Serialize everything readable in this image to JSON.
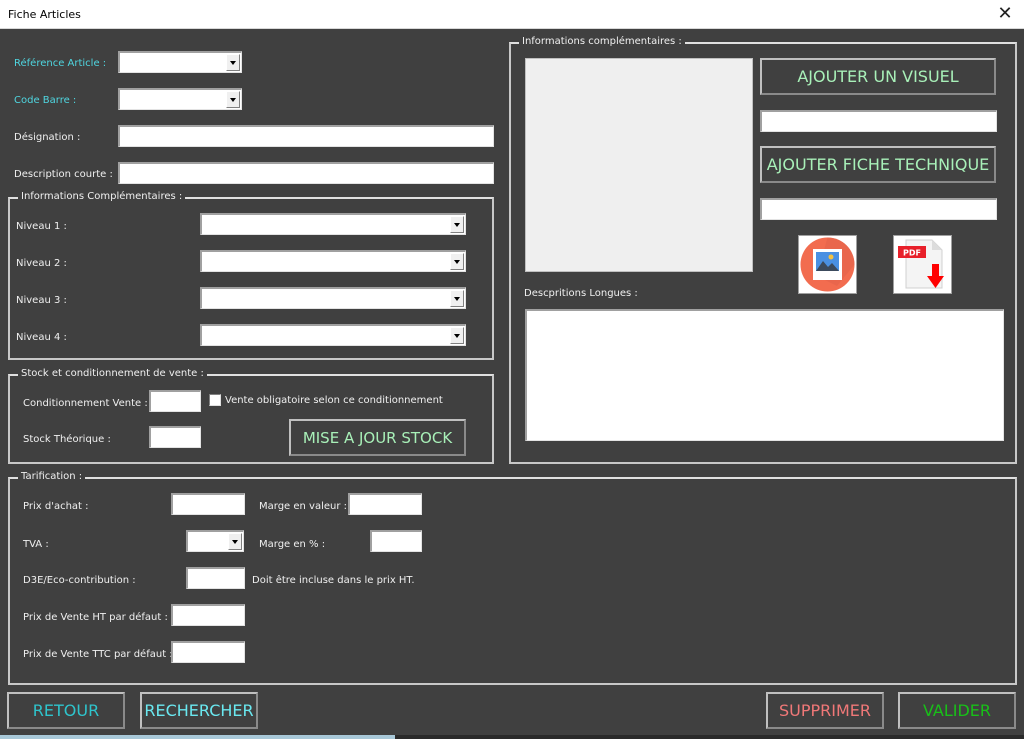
{
  "window": {
    "title": "Fiche Articles",
    "close_icon": "close-icon"
  },
  "article": {
    "reference_label": "Référence Article :",
    "reference_value": "",
    "barcode_label": "Code Barre :",
    "barcode_value": "",
    "designation_label": "Désignation :",
    "designation_value": "",
    "short_description_label": "Description courte :",
    "short_description_value": ""
  },
  "info_group": {
    "title": "Informations Complémentaires :",
    "levels": [
      {
        "label": "Niveau 1 :",
        "value": ""
      },
      {
        "label": "Niveau 2 :",
        "value": ""
      },
      {
        "label": "Niveau 3 :",
        "value": ""
      },
      {
        "label": "Niveau 4  :",
        "value": ""
      }
    ]
  },
  "stock_group": {
    "title": "Stock et conditionnement de vente :",
    "packaging_label": "Conditionnement Vente :",
    "packaging_value": "",
    "mandatory_checkbox_label": "Vente obligatoire selon ce conditionnement",
    "mandatory_checked": false,
    "theoretical_stock_label": "Stock Théorique :",
    "theoretical_stock_value": "",
    "update_stock_button": "MISE A JOUR STOCK"
  },
  "extra_group": {
    "title": "Informations complémentaires :",
    "add_visual_button": "AJOUTER UN VISUEL",
    "visual_path_value": "",
    "add_datasheet_button": "AJOUTER FICHE TECHNIQUE",
    "datasheet_path_value": "",
    "image_icon": "image-icon",
    "pdf_icon": "pdf-download-icon",
    "pdf_badge": "PDF",
    "long_descriptions_label": "Descpritions Longues :",
    "long_descriptions_value": ""
  },
  "pricing_group": {
    "title": "Tarification :",
    "purchase_price_label": "Prix d'achat :",
    "purchase_price_value": "",
    "margin_value_label": "Marge en valeur :",
    "margin_value_value": "",
    "vat_label": "TVA :",
    "vat_value": "",
    "margin_percent_label": "Marge en % :",
    "margin_percent_value": "",
    "eco_label": "D3E/Eco-contribution :",
    "eco_value": "",
    "eco_note": "Doit être incluse dans le prix HT.",
    "default_price_ht_label": "Prix de Vente HT par défaut :",
    "default_price_ht_value": "",
    "default_price_ttc_label": "Prix de Vente TTC  par défaut :",
    "default_price_ttc_value": ""
  },
  "actions": {
    "back": "RETOUR",
    "search": "RECHERCHER",
    "delete": "SUPPRIMER",
    "validate": "VALIDER"
  },
  "colors": {
    "background": "#404040",
    "label_accent": "#4fd6e0",
    "button_text_light_green": "#a8f0b8",
    "back_button": "#2ec4cc",
    "search_button": "#6ae8f0",
    "delete_button": "#f07878",
    "validate_button": "#18c018"
  }
}
